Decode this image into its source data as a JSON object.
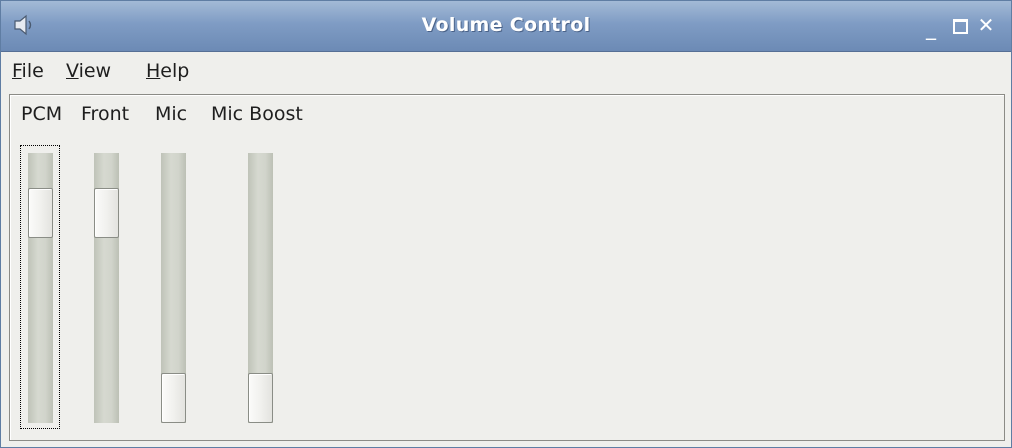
{
  "window": {
    "title": "Volume Control"
  },
  "menu": {
    "file": "File",
    "view": "View",
    "help": "Help"
  },
  "channels": [
    {
      "label": "PCM",
      "level": 0.84,
      "focused": true
    },
    {
      "label": "Front",
      "level": 0.84,
      "focused": false
    },
    {
      "label": "Mic",
      "level": 0.0,
      "focused": false
    },
    {
      "label": "Mic Boost",
      "level": 0.0,
      "focused": false
    }
  ],
  "colors": {
    "titlebar": "#7f9cc4",
    "window_bg": "#efefec"
  },
  "icons": {
    "app": "speaker-icon",
    "minimize": "minimize-icon",
    "maximize": "maximize-icon",
    "close": "close-icon"
  }
}
